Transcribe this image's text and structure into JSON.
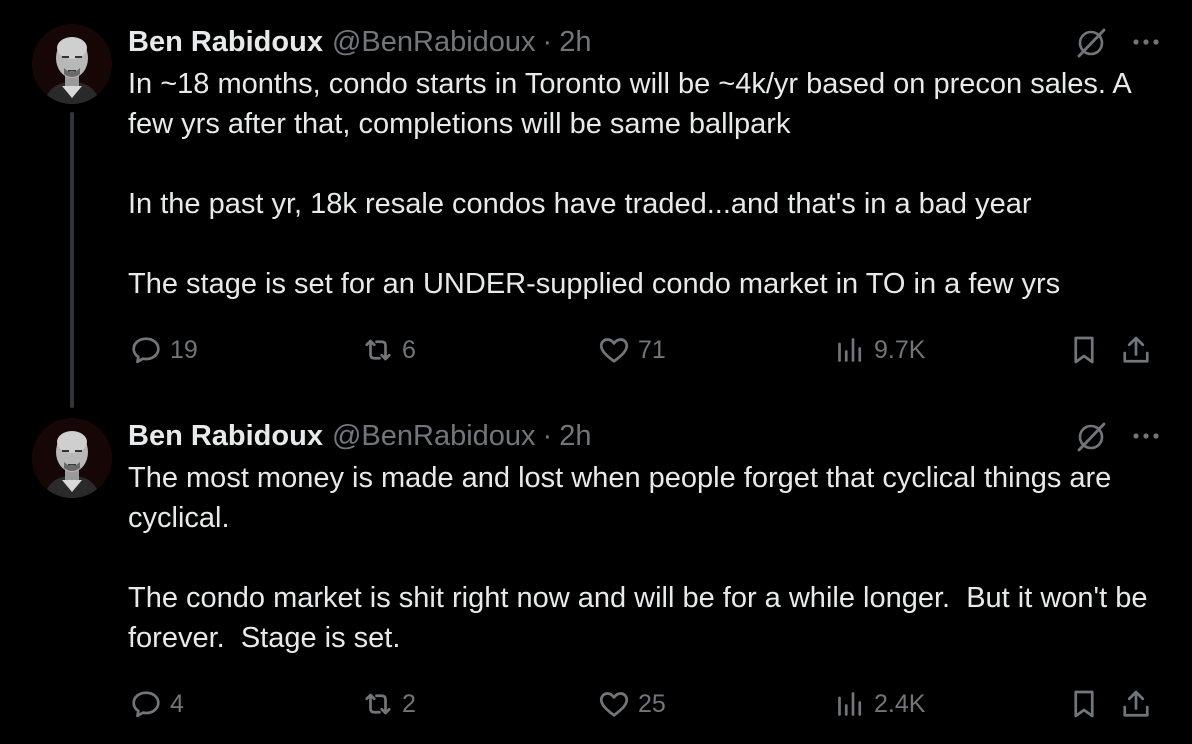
{
  "tweets": [
    {
      "author": {
        "name": "Ben Rabidoux",
        "handle": "@BenRabidoux"
      },
      "separator": "·",
      "time": "2h",
      "paragraphs": [
        "In ~18 months, condo starts in Toronto will be ~4k/yr based on precon sales. A few yrs after that, completions will be same ballpark",
        "In the past yr, 18k resale condos have traded...and that's in a bad year",
        "The stage is set for an UNDER-supplied condo market in TO in a few yrs"
      ],
      "stats": {
        "replies": "19",
        "reposts": "6",
        "likes": "71",
        "views": "9.7K"
      }
    },
    {
      "author": {
        "name": "Ben Rabidoux",
        "handle": "@BenRabidoux"
      },
      "separator": "·",
      "time": "2h",
      "paragraphs": [
        "The most money is made and lost when people forget that cyclical things are cyclical.",
        "The condo market is shit right now and will be for a while longer.  But it won't be forever.  Stage is set."
      ],
      "stats": {
        "replies": "4",
        "reposts": "2",
        "likes": "25",
        "views": "2.4K"
      }
    }
  ],
  "icons": {
    "reply": "reply-icon",
    "repost": "repost-icon",
    "like": "like-icon",
    "views": "views-icon",
    "bookmark": "bookmark-icon",
    "share": "share-icon",
    "grok": "grok-icon",
    "more": "more-icon"
  },
  "colors": {
    "background": "#000000",
    "text": "#e7e9ea",
    "secondary": "#71767b",
    "thread_line": "#333639"
  }
}
